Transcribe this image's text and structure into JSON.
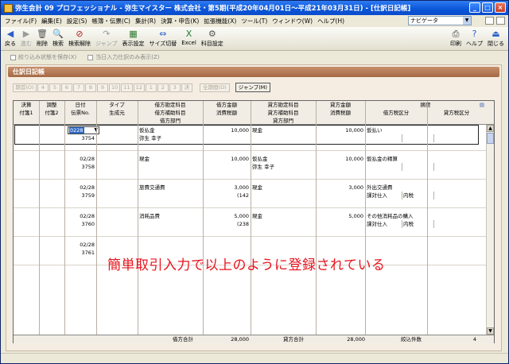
{
  "window": {
    "title": "弥生会計 09 プロフェッショナル - 弥生マイスター 株式会社・第5期(平成20年04月01日～平成21年03月31日) - [仕訳日記帳]",
    "controls": [
      "_",
      "□",
      "×"
    ]
  },
  "menu": {
    "items": [
      "ファイル(F)",
      "編集(E)",
      "設定(S)",
      "帳簿・伝票(C)",
      "集計(R)",
      "決算・申告(K)",
      "拡張機能(X)",
      "ツール(T)",
      "ウィンドウ(W)",
      "ヘルプ(H)"
    ],
    "navigator": "ナビゲータ"
  },
  "toolbar": {
    "left": [
      {
        "label": "戻る",
        "icon": "back-icon",
        "glyph": "◀",
        "color": "#2a5fc8",
        "enabled": true
      },
      {
        "label": "進む",
        "icon": "forward-icon",
        "glyph": "▶",
        "color": "#9a9a9a",
        "enabled": false
      },
      {
        "label": "削除",
        "icon": "trash-icon",
        "glyph": "🗑",
        "color": "#555555",
        "enabled": true
      },
      {
        "label": "検索",
        "icon": "search-icon",
        "glyph": "🔍",
        "color": "#333333",
        "enabled": true
      },
      {
        "label": "検索解除",
        "icon": "search-clear-icon",
        "glyph": "⊘",
        "color": "#b02020",
        "enabled": true
      },
      {
        "label": "ジャンプ",
        "icon": "jump-icon",
        "glyph": "↷",
        "color": "#9a9a9a",
        "enabled": false
      },
      {
        "label": "表示設定",
        "icon": "display-settings-icon",
        "glyph": "▦",
        "color": "#2a7a2a",
        "enabled": true
      },
      {
        "label": "サイズ切替",
        "icon": "size-toggle-icon",
        "glyph": "⇔",
        "color": "#2a5fc8",
        "enabled": true
      },
      {
        "label": "Excel",
        "icon": "excel-icon",
        "glyph": "X",
        "color": "#1d7a34",
        "enabled": true
      },
      {
        "label": "科目設定",
        "icon": "account-settings-icon",
        "glyph": "⚙",
        "color": "#555555",
        "enabled": true
      }
    ],
    "right": [
      {
        "label": "印刷",
        "icon": "printer-icon",
        "glyph": "⎙",
        "color": "#333333",
        "enabled": true
      },
      {
        "label": "ヘルプ",
        "icon": "help-icon",
        "glyph": "?",
        "color": "#2a5fc8",
        "enabled": true
      },
      {
        "label": "閉じる",
        "icon": "close-door-icon",
        "glyph": "⏏",
        "color": "#2a5fc8",
        "enabled": true
      }
    ]
  },
  "options": {
    "opt1": "絞り込み状態を保存(X)",
    "opt2": "当日入力仕訳のみ表示(Z)"
  },
  "panel": {
    "title": "仕訳日記帳",
    "months": [
      "期首(O)",
      "4",
      "5",
      "6",
      "7",
      "8",
      "9",
      "10",
      "11",
      "12",
      "1",
      "2",
      "3",
      "決"
    ],
    "period_button": "全期間(D)",
    "jump_button": "ジャンプ(M)"
  },
  "columns": {
    "row1": [
      "決算",
      "調整",
      "日付",
      "タイプ",
      "借方勘定科目",
      "借方金額",
      "貸方勘定科目",
      "貸方金額",
      "摘要"
    ],
    "row2": [
      "付箋1",
      "付箋2",
      "伝票No.",
      "生成元",
      "借方補助科目",
      "消費税額",
      "貸方補助科目",
      "消費税額",
      "借方税区分",
      "貸方税区分"
    ],
    "row3": [
      "借方部門",
      "貸方部門"
    ]
  },
  "entries": [
    {
      "date": "02/28",
      "no": "3754",
      "dr_account": "仮払金",
      "dr_sub": "弥生 幸子",
      "dr_amount": "10,000",
      "dr_tax": "",
      "cr_account": "現金",
      "cr_sub": "",
      "cr_amount": "10,000",
      "cr_tax": "",
      "memo": "仮払い",
      "dr_taxcat": "",
      "cr_taxcat": ""
    },
    {
      "date": "02/28",
      "no": "3758",
      "dr_account": "現金",
      "dr_sub": "",
      "dr_amount": "10,000",
      "dr_tax": "",
      "cr_account": "仮払金",
      "cr_sub": "弥生 幸子",
      "cr_amount": "10,000",
      "cr_tax": "",
      "memo": "仮払金の精算",
      "dr_taxcat": "",
      "cr_taxcat": ""
    },
    {
      "date": "02/28",
      "no": "3759",
      "dr_account": "旅費交通費",
      "dr_sub": "",
      "dr_amount": "3,000",
      "dr_tax": "(142",
      "cr_account": "現金",
      "cr_sub": "",
      "cr_amount": "3,000",
      "cr_tax": "",
      "memo": "外出交通費",
      "dr_taxcat": "課対仕入",
      "cr_taxcat": "内税"
    },
    {
      "date": "02/28",
      "no": "3760",
      "dr_account": "消耗品費",
      "dr_sub": "",
      "dr_amount": "5,000",
      "dr_tax": "(238",
      "cr_account": "現金",
      "cr_sub": "",
      "cr_amount": "5,000",
      "cr_tax": "",
      "memo": "その他消耗品の購入",
      "dr_taxcat": "課対仕入",
      "cr_taxcat": "内税"
    },
    {
      "date": "02/28",
      "no": "3761",
      "dr_account": "",
      "dr_sub": "",
      "dr_amount": "",
      "dr_tax": "",
      "cr_account": "",
      "cr_sub": "",
      "cr_amount": "",
      "cr_tax": "",
      "memo": "",
      "dr_taxcat": "",
      "cr_taxcat": ""
    }
  ],
  "editing_date": "0228",
  "footer": {
    "dr_total_label": "借方合計",
    "dr_total": "28,000",
    "cr_total_label": "貸方合計",
    "cr_total": "28,000",
    "count_label": "絞込件数",
    "count": "4"
  },
  "annotation": "簡単取引入力で以上のように登録されている",
  "colors": {
    "title_bar": "#0a55d8",
    "panel_header": "#b47a55",
    "annotation": "#e8141e",
    "selection": "#316ac5"
  }
}
